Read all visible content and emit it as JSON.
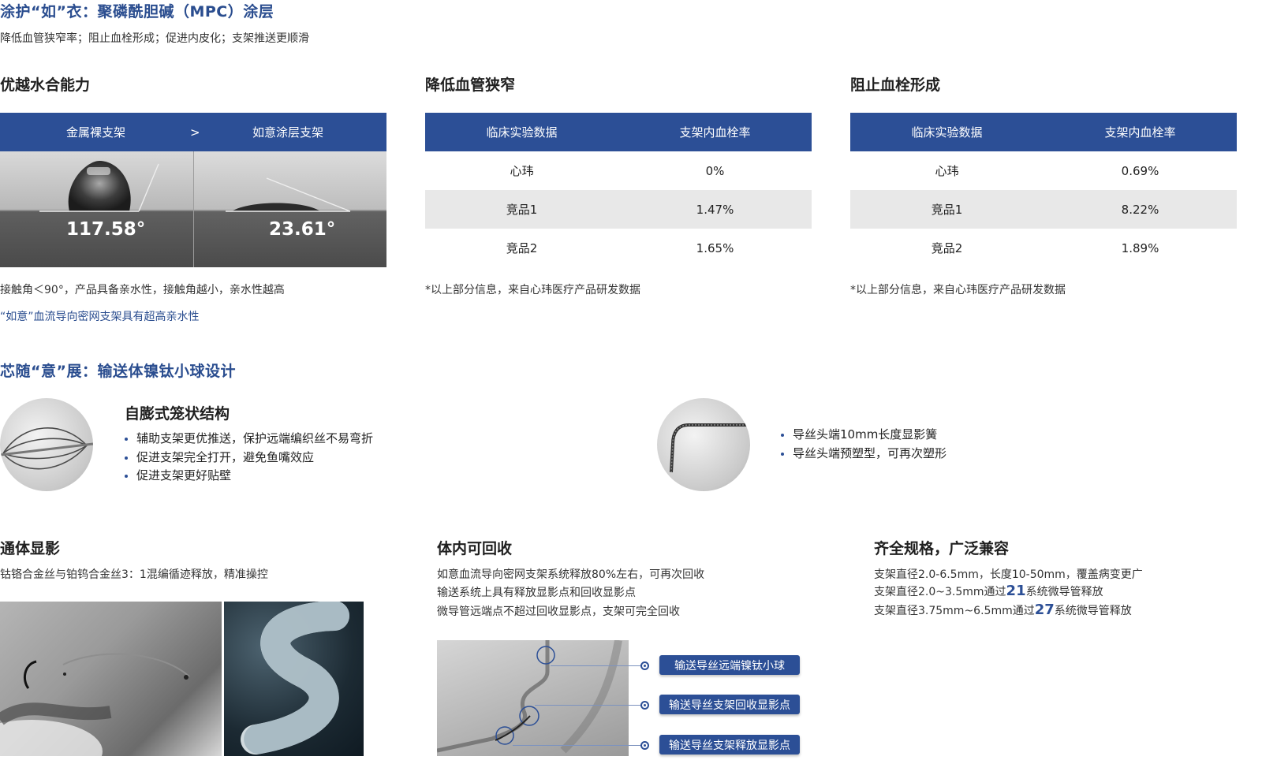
{
  "section1": {
    "title": "涂护“如”衣：聚磷酰胆碱（MPC）涂层",
    "subtitle": "降低血管狭窄率；阻止血栓形成；促进内皮化；支架推送更顺滑"
  },
  "hydration": {
    "title": "优越水合能力",
    "header_left": "金属裸支架",
    "header_sep": ">",
    "header_right": "如意涂层支架",
    "angle_left": "117.58°",
    "angle_right": "23.61°",
    "note": "接触角＜90°，产品具备亲水性，接触角越小，亲水性越高",
    "note_blue": "“如意”血流导向密网支架具有超高亲水性"
  },
  "stenosis": {
    "title": "降低血管狭窄",
    "headers": [
      "临床实验数据",
      "支架内血栓率"
    ],
    "rows": [
      [
        "心玮",
        "0%"
      ],
      [
        "竞品1",
        "1.47%"
      ],
      [
        "竞品2",
        "1.65%"
      ]
    ],
    "footnote": "*以上部分信息，来自心玮医疗产品研发数据"
  },
  "thrombus": {
    "title": "阻止血栓形成",
    "headers": [
      "临床实验数据",
      "支架内血栓率"
    ],
    "rows": [
      [
        "心玮",
        "0.69%"
      ],
      [
        "竞品1",
        "8.22%"
      ],
      [
        "竞品2",
        "1.89%"
      ]
    ],
    "footnote": "*以上部分信息，来自心玮医疗产品研发数据"
  },
  "section2": {
    "title": "芯随“意”展：输送体镍钛小球设计"
  },
  "cage": {
    "title": "自膨式笼状结构",
    "bullets": [
      "辅助支架更优推送，保护远端编织丝不易弯折",
      "促进支架完全打开，避免鱼嘴效应",
      "促进支架更好贴壁"
    ]
  },
  "guidewire": {
    "bullets": [
      "导丝头端10mm长度显影簧",
      "导丝头端预塑型，可再次塑形"
    ]
  },
  "visibility": {
    "title": "通体显影",
    "desc": "钴铬合金丝与铂钨合金丝3：1混编循迹释放，精准操控"
  },
  "retrieve": {
    "title": "体内可回收",
    "lines": [
      "如意血流导向密网支架系统释放80%左右，可再次回收",
      "输送系统上具有释放显影点和回收显影点",
      "微导管远端点不超过回收显影点，支架可完全回收"
    ],
    "tags": [
      "输送导丝远端镍钛小球",
      "输送导丝支架回收显影点",
      "输送导丝支架释放显影点"
    ]
  },
  "specs": {
    "title": "齐全规格，广泛兼容",
    "line1": "支架直径2.0-6.5mm，长度10-50mm，覆盖病变更广",
    "line2_pre": "支架直径2.0~3.5mm通过",
    "line2_num": "21",
    "line2_post": "系统微导管释放",
    "line3_pre": "支架直径3.75mm~6.5mm通过",
    "line3_num": "27",
    "line3_post": "系统微导管释放"
  }
}
